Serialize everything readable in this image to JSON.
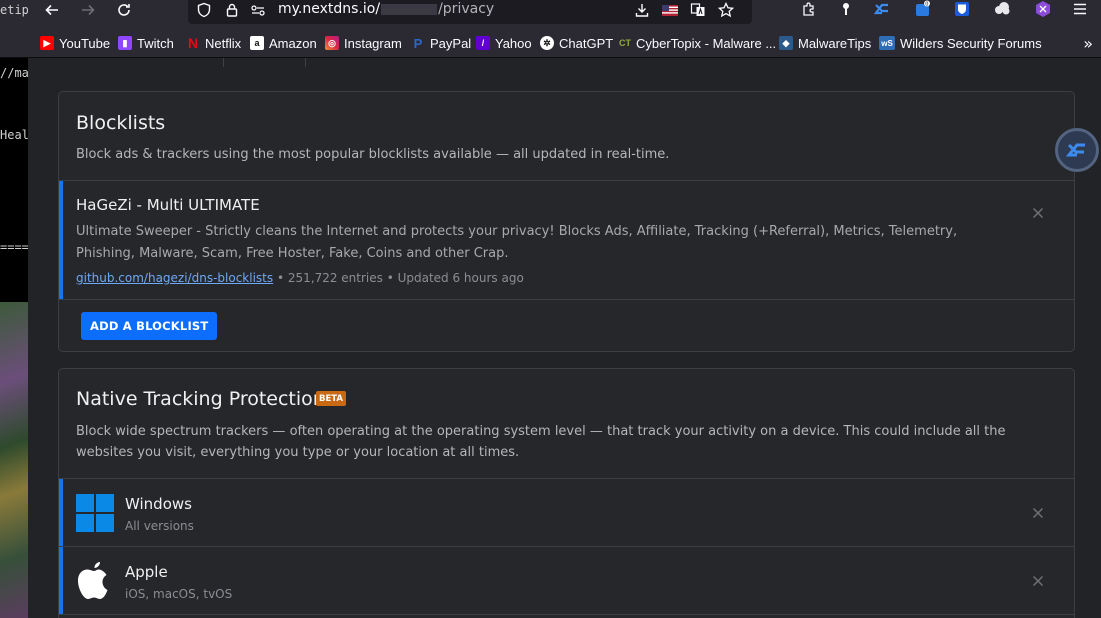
{
  "browser": {
    "url": {
      "host": "my.nextdns.io/",
      "path": "/privacy"
    },
    "bookmarks": [
      {
        "label": "YouTube",
        "color": "#ff0000"
      },
      {
        "label": "Twitch",
        "color": "#9146ff"
      },
      {
        "label": "Netflix",
        "color": "#e50914"
      },
      {
        "label": "Amazon",
        "color": "#ffffff"
      },
      {
        "label": "Instagram",
        "color": "#d6249f"
      },
      {
        "label": "PayPal",
        "color": "#2a67c9"
      },
      {
        "label": "Yahoo",
        "color": "#6001d2"
      },
      {
        "label": "ChatGPT",
        "color": "#ffffff"
      },
      {
        "label": "CyberTopix - Malware ...",
        "color": "#8fae3b",
        "fav_text": "CT"
      },
      {
        "label": "MalwareTips",
        "color": "#2b5a8a"
      },
      {
        "label": "Wilders Security Forums",
        "color": "#2f6db5",
        "fav_text": "wS"
      }
    ]
  },
  "left_strip": {
    "lines": [
      "etip",
      "//ma",
      "Heal",
      "===="
    ]
  },
  "blocklists": {
    "title": "Blocklists",
    "description": "Block ads & trackers using the most popular blocklists available — all updated in real-time.",
    "items": [
      {
        "name": "HaGeZi - Multi ULTIMATE",
        "description": "Ultimate Sweeper - Strictly cleans the Internet and protects your privacy! Blocks Ads, Affiliate, Tracking (+Referral), Metrics, Telemetry, Phishing, Malware, Scam, Free Hoster, Fake, Coins and other Crap.",
        "link": "github.com/hagezi/dns-blocklists",
        "meta": " • 251,722 entries • Updated 6 hours ago"
      }
    ],
    "add_label": "ADD A BLOCKLIST"
  },
  "native_tracking": {
    "title": "Native Tracking Protection",
    "badge": "BETA",
    "description": "Block wide spectrum trackers — often operating at the operating system level — that track your activity on a device. This could include all the websites you visit, everything you type or your location at all times.",
    "items": [
      {
        "name": "Windows",
        "subtitle": "All versions",
        "icon": "windows-logo-icon"
      },
      {
        "name": "Apple",
        "subtitle": "iOS, macOS, tvOS",
        "icon": "apple-logo-icon"
      }
    ]
  },
  "colors": {
    "accent": "#1a73e8",
    "button": "#0d6efd",
    "badge": "#c96a12",
    "windows_blue": "#0a8ae6"
  }
}
